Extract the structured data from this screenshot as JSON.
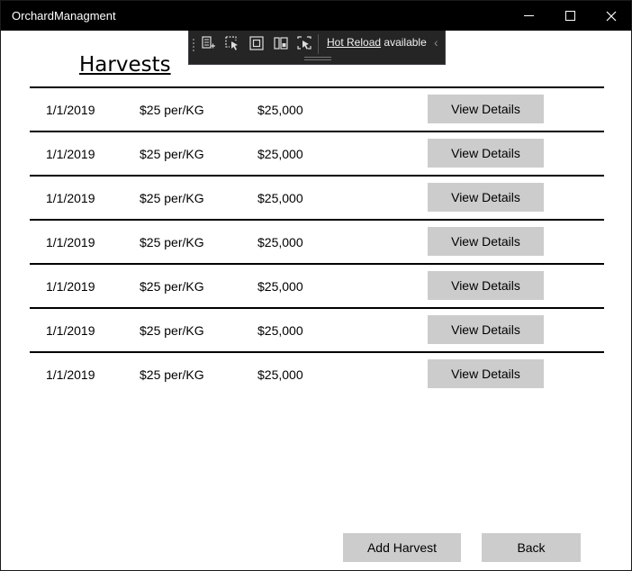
{
  "window": {
    "title": "OrchardManagment"
  },
  "devtools_toolbar": {
    "hot_reload_link": "Hot Reload",
    "hot_reload_status": "available",
    "icons": [
      "live-visual-tree-icon",
      "select-element-icon",
      "display-layout-adorners-icon",
      "track-focus-icon",
      "binding-failures-icon"
    ]
  },
  "page": {
    "title": "Harvests"
  },
  "harvests": [
    {
      "date": "1/1/2019",
      "price": "$25 per/KG",
      "total": "$25,000",
      "action": "View Details"
    },
    {
      "date": "1/1/2019",
      "price": "$25 per/KG",
      "total": "$25,000",
      "action": "View Details"
    },
    {
      "date": "1/1/2019",
      "price": "$25 per/KG",
      "total": "$25,000",
      "action": "View Details"
    },
    {
      "date": "1/1/2019",
      "price": "$25 per/KG",
      "total": "$25,000",
      "action": "View Details"
    },
    {
      "date": "1/1/2019",
      "price": "$25 per/KG",
      "total": "$25,000",
      "action": "View Details"
    },
    {
      "date": "1/1/2019",
      "price": "$25 per/KG",
      "total": "$25,000",
      "action": "View Details"
    },
    {
      "date": "1/1/2019",
      "price": "$25 per/KG",
      "total": "$25,000",
      "action": "View Details"
    }
  ],
  "footer": {
    "add_label": "Add Harvest",
    "back_label": "Back"
  },
  "colors": {
    "titlebar": "#000000",
    "button": "#cccccc",
    "toolbar": "#252526"
  }
}
